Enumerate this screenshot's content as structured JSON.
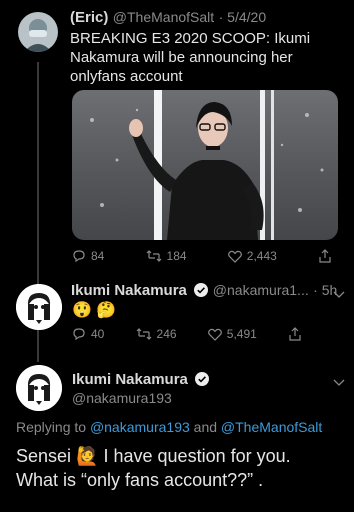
{
  "tweet1": {
    "name": "(Eric)",
    "handle": "@TheManofSalt",
    "date": "· 5/4/20",
    "text": "BREAKING E3 2020 SCOOP: Ikumi Nakamura will be announcing her onlyfans account",
    "replies": "84",
    "retweets": "184",
    "likes": "2,443"
  },
  "tweet2": {
    "name": "Ikumi Nakamura",
    "handle": "@nakamura1...",
    "time": "· 5h",
    "emojis": "😲 🤔",
    "replies": "40",
    "retweets": "246",
    "likes": "5,491"
  },
  "tweet3": {
    "name": "Ikumi Nakamura",
    "handle": "@nakamura193",
    "replying_prefix": "Replying to",
    "replying_mention1": "@nakamura193",
    "replying_and": "and",
    "replying_mention2": "@TheManofSalt",
    "line1_a": "Sensei",
    "line1_emoji": "🙋",
    "line1_b": "I have question for you.",
    "line2": "What is “only fans account??” ."
  },
  "colors": {
    "background": "#000000",
    "link": "#3d9bd9",
    "verified": "#1d9bf0",
    "muted": "#8a8a8a"
  }
}
